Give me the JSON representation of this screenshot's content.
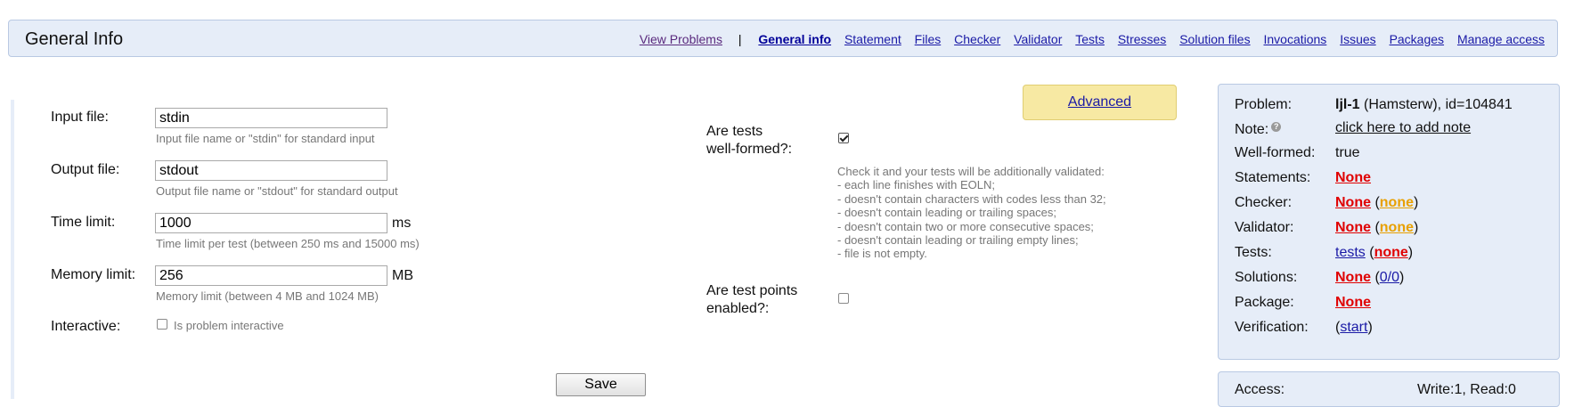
{
  "header": {
    "title": "General Info",
    "nav_first": "View Problems",
    "separator": "|",
    "nav": [
      "General info",
      "Statement",
      "Files",
      "Checker",
      "Validator",
      "Tests",
      "Stresses",
      "Solution files",
      "Invocations",
      "Issues",
      "Packages",
      "Manage access"
    ]
  },
  "form": {
    "input_file": {
      "label": "Input file:",
      "value": "stdin",
      "hint": "Input file name or \"stdin\" for standard input"
    },
    "output_file": {
      "label": "Output file:",
      "value": "stdout",
      "hint": "Output file name or \"stdout\" for standard output"
    },
    "time_limit": {
      "label": "Time limit:",
      "value": "1000",
      "unit": "ms",
      "hint": "Time limit per test (between 250 ms and 15000 ms)"
    },
    "memory_limit": {
      "label": "Memory limit:",
      "value": "256",
      "unit": "MB",
      "hint": "Memory limit (between 4 MB and 1024 MB)"
    },
    "interactive": {
      "label": "Interactive:",
      "checkbox_label": "Is problem interactive",
      "checked": false
    },
    "save_label": "Save"
  },
  "advanced_label": "Advanced",
  "well_formed": {
    "label_line1": "Are tests",
    "label_line2": "well-formed?:",
    "checked": true,
    "help": [
      "Check it and your tests will be additionally validated:",
      "- each line finishes with EOLN;",
      "- doesn't contain characters with codes less than 32;",
      "- doesn't contain leading or trailing spaces;",
      "- doesn't contain two or more consecutive spaces;",
      "- doesn't contain leading or trailing empty lines;",
      "- file is not empty."
    ]
  },
  "test_points": {
    "label_line1": "Are test points",
    "label_line2": "enabled?:",
    "checked": false
  },
  "panel": {
    "problem_label": "Problem:",
    "problem_name": "ljl-1",
    "problem_owner": " (Hamsterw), id=104841",
    "note_label": "Note:",
    "note_link": "click here to add note",
    "note_help": "?",
    "wellformed_label": "Well-formed:",
    "wellformed_value": "true",
    "statements_label": "Statements:",
    "statements_value": "None",
    "checker_label": "Checker:",
    "checker_value": "None",
    "checker_sub": "none",
    "validator_label": "Validator:",
    "validator_value": "None",
    "validator_sub": "none",
    "tests_label": "Tests:",
    "tests_value": "tests",
    "tests_sub": "none",
    "solutions_label": "Solutions:",
    "solutions_value": "None",
    "solutions_sub": "0/0",
    "package_label": "Package:",
    "package_value": "None",
    "verification_label": "Verification:",
    "verification_link": "start",
    "access_label": "Access:",
    "access_value": "Write:1, Read:0"
  },
  "colors": {
    "header_bg": "#e6edf8",
    "advanced_bg": "#f7e9a3",
    "none_red": "#e00000",
    "none_orange": "#e8a000"
  }
}
